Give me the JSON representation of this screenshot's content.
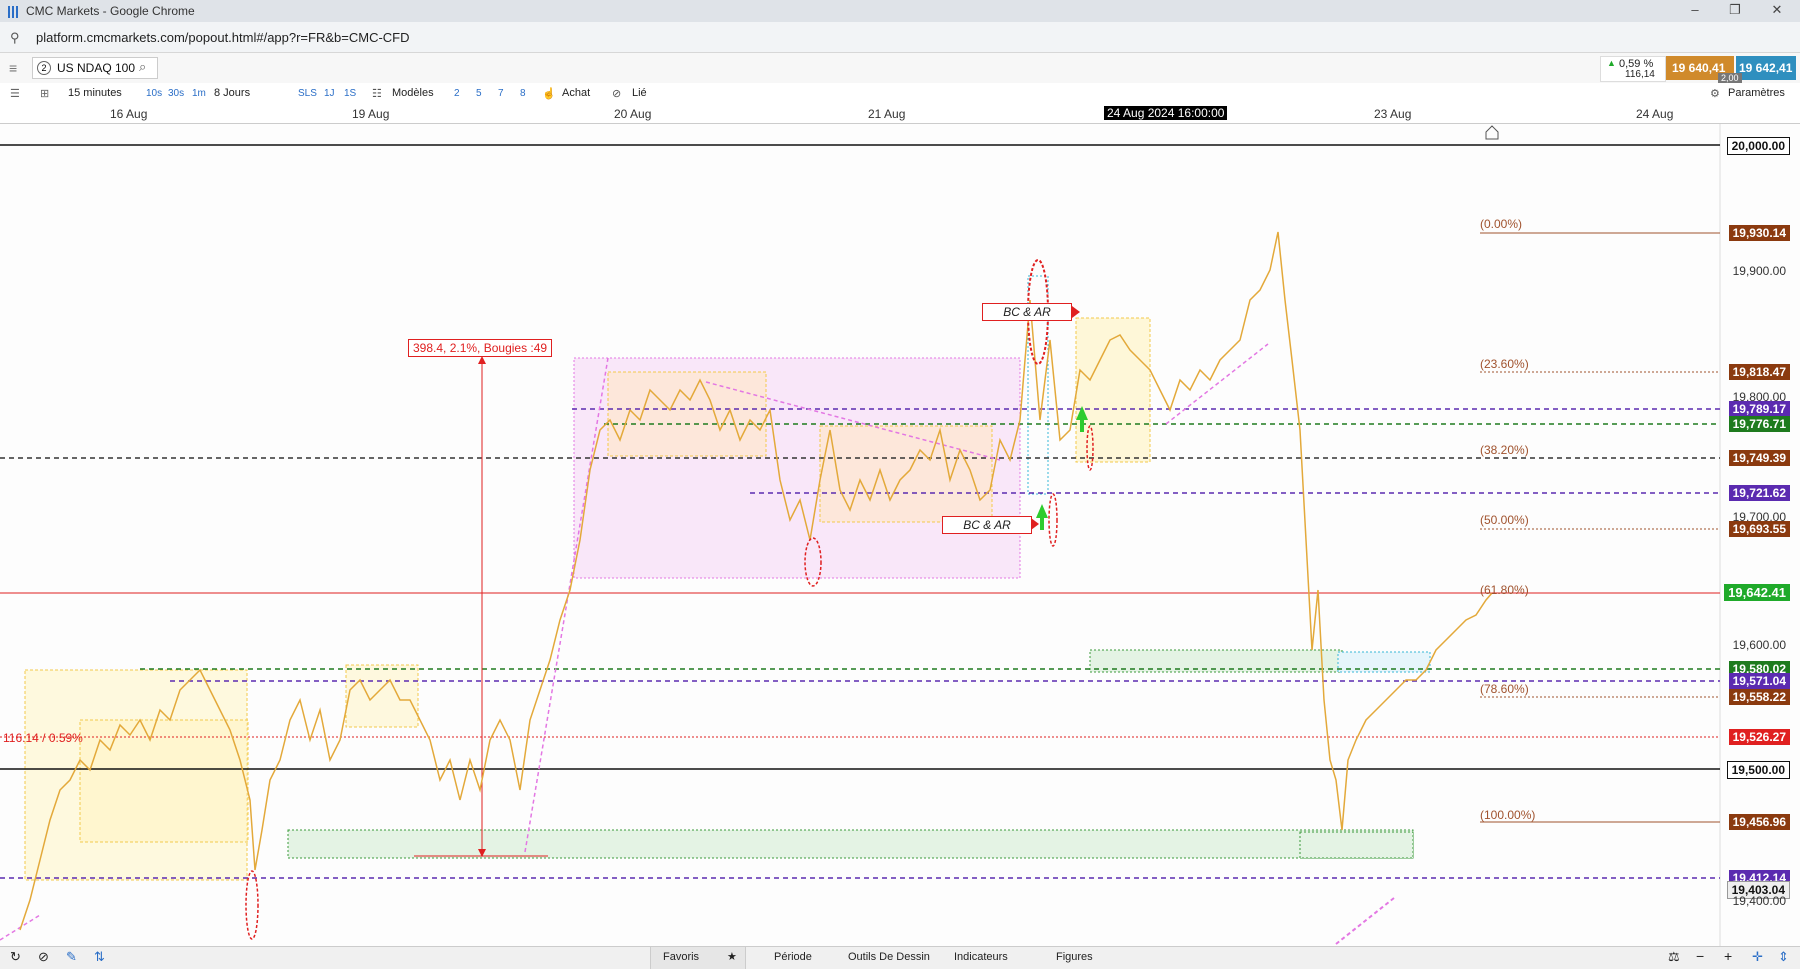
{
  "window": {
    "title": "CMC Markets - Google Chrome",
    "url": "platform.cmcmarkets.com/popout.html#/app?r=FR&b=CMC-CFD"
  },
  "instrument": {
    "badge": "2",
    "name": "US NDAQ 100",
    "change_pct": "0,59 %",
    "change_pts": "116,14",
    "sell_price": "19 640,41",
    "buy_price": "19 642,41",
    "spread": "2,00"
  },
  "toolbar": {
    "timeframe": "15 minutes",
    "quick_periods": [
      "10s",
      "30s",
      "1m"
    ],
    "range": "8 Jours",
    "quick_ranges": [
      "SLS",
      "1J",
      "1S"
    ],
    "models_label": "Modèles",
    "counts": [
      "2",
      "5",
      "7",
      "8"
    ],
    "buy_label": "Achat",
    "linked_label": "Lié",
    "settings_label": "Paramètres"
  },
  "date_axis": {
    "labels": [
      "16 Aug",
      "19 Aug",
      "20 Aug",
      "21 Aug",
      "23 Aug",
      "24 Aug"
    ],
    "crosshair": "24 Aug 2024 16:00:00"
  },
  "price_axis": {
    "ticks": [
      "19,900.00",
      "19,800.00",
      "19,700.00",
      "19,600.00",
      "19,400.00"
    ],
    "tags": {
      "p20000": "20,000.00",
      "p19930": "19,930.14",
      "p19818": "19,818.47",
      "p19789": "19,789.17",
      "p19776": "19,776.71",
      "p19749": "19,749.39",
      "p19721": "19,721.62",
      "p19693": "19,693.55",
      "p19642": "19,642.41",
      "p19580": "19,580.02",
      "p19571": "19,571.04",
      "p19558": "19,558.22",
      "p19526": "19,526.27",
      "p19500": "19,500.00",
      "p19456": "19,456.96",
      "p19412": "19,412.14",
      "p19403": "19,403.04"
    }
  },
  "fibonacci": [
    "(0.00%)",
    "(23.60%)",
    "(38.20%)",
    "(50.00%)",
    "(61.80%)",
    "(78.60%)",
    "(100.00%)"
  ],
  "annotations": {
    "measure": "398.4, 2.1%, Bougies :49",
    "bc_ar_1": "BC & AR",
    "bc_ar_2": "BC & AR",
    "change_line": "116.14 / 0.59%"
  },
  "bottom_bar": {
    "favorites": "Favoris",
    "period": "Période",
    "drawing_tools": "Outils De Dessin",
    "indicators": "Indicateurs",
    "figures": "Figures"
  },
  "colors": {
    "sell": "#d08a2b",
    "buy": "#2f8fbf",
    "last": "#1faa2a",
    "red": "#e02020",
    "purple": "#5b2bb0",
    "fib": "#a0522d",
    "dark_tag": "#6e2a0c"
  }
}
